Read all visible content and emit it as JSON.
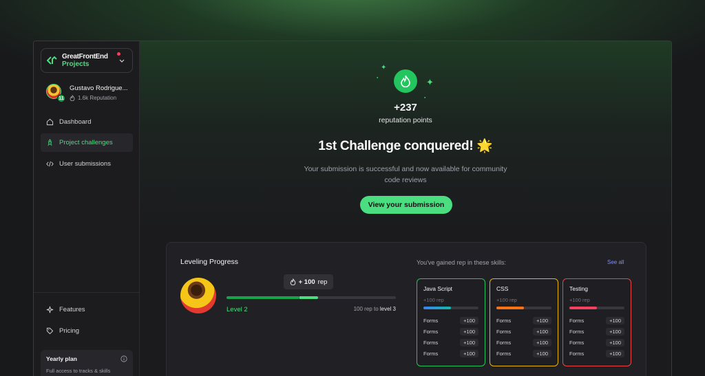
{
  "brand": {
    "name": "GreatFrontEnd",
    "product": "Projects"
  },
  "user": {
    "name": "Gustavo Rodrigue...",
    "reputation": "1.6k Reputation",
    "level": "11"
  },
  "nav": {
    "items": [
      {
        "label": "Dashboard",
        "icon": "home-icon"
      },
      {
        "label": "Project challenges",
        "icon": "rocket-icon",
        "active": true
      },
      {
        "label": "User submissions",
        "icon": "code-icon"
      }
    ],
    "bottom": [
      {
        "label": "Features",
        "icon": "sparkle-icon"
      },
      {
        "label": "Pricing",
        "icon": "tag-icon"
      }
    ]
  },
  "plan": {
    "title": "Yearly plan",
    "desc": "Full access to tracks & skills"
  },
  "reward": {
    "points": "+237",
    "points_label": "reputation points",
    "headline": "1st Challenge conquered! 🌟",
    "description": "Your submission is successful and now available for community code reviews",
    "cta": "View your submission"
  },
  "leveling": {
    "title": "Leveling Progress",
    "tooltip_prefix": "+ 100",
    "tooltip_suffix": "rep",
    "level": "Level 2",
    "rep_to_prefix": "100 rep to",
    "rep_to_level": "level 3",
    "progress_before": 0.43,
    "progress_after": 0.54
  },
  "skills": {
    "title": "You've gained rep in these skills:",
    "see_all": "See all",
    "cards": [
      {
        "name": "Java Script",
        "rep": "+100 rep",
        "border": "#22c55e",
        "bar": "#3b82f6",
        "bar_end": "#14b8a6",
        "fill": 0.5,
        "rows": [
          {
            "label": "Forms",
            "value": "+100"
          },
          {
            "label": "Forms",
            "value": "+100"
          },
          {
            "label": "Forms",
            "value": "+100"
          },
          {
            "label": "Forms",
            "value": "+100"
          }
        ]
      },
      {
        "name": "CSS",
        "rep": "+100 rep",
        "border": "#eab308",
        "bar": "#f97316",
        "bar_end": "#f97316",
        "fill": 0.5,
        "rows": [
          {
            "label": "Forms",
            "value": "+100"
          },
          {
            "label": "Forms",
            "value": "+100"
          },
          {
            "label": "Forms",
            "value": "+100"
          },
          {
            "label": "Forms",
            "value": "+100"
          }
        ]
      },
      {
        "name": "Testing",
        "rep": "+100 rep",
        "border": "#ef4444",
        "bar": "#f43f5e",
        "bar_end": "#f43f5e",
        "fill": 0.5,
        "rows": [
          {
            "label": "Forms",
            "value": "+100"
          },
          {
            "label": "Forms",
            "value": "+100"
          },
          {
            "label": "Forms",
            "value": "+100"
          },
          {
            "label": "Forms",
            "value": "+100"
          }
        ]
      }
    ]
  }
}
